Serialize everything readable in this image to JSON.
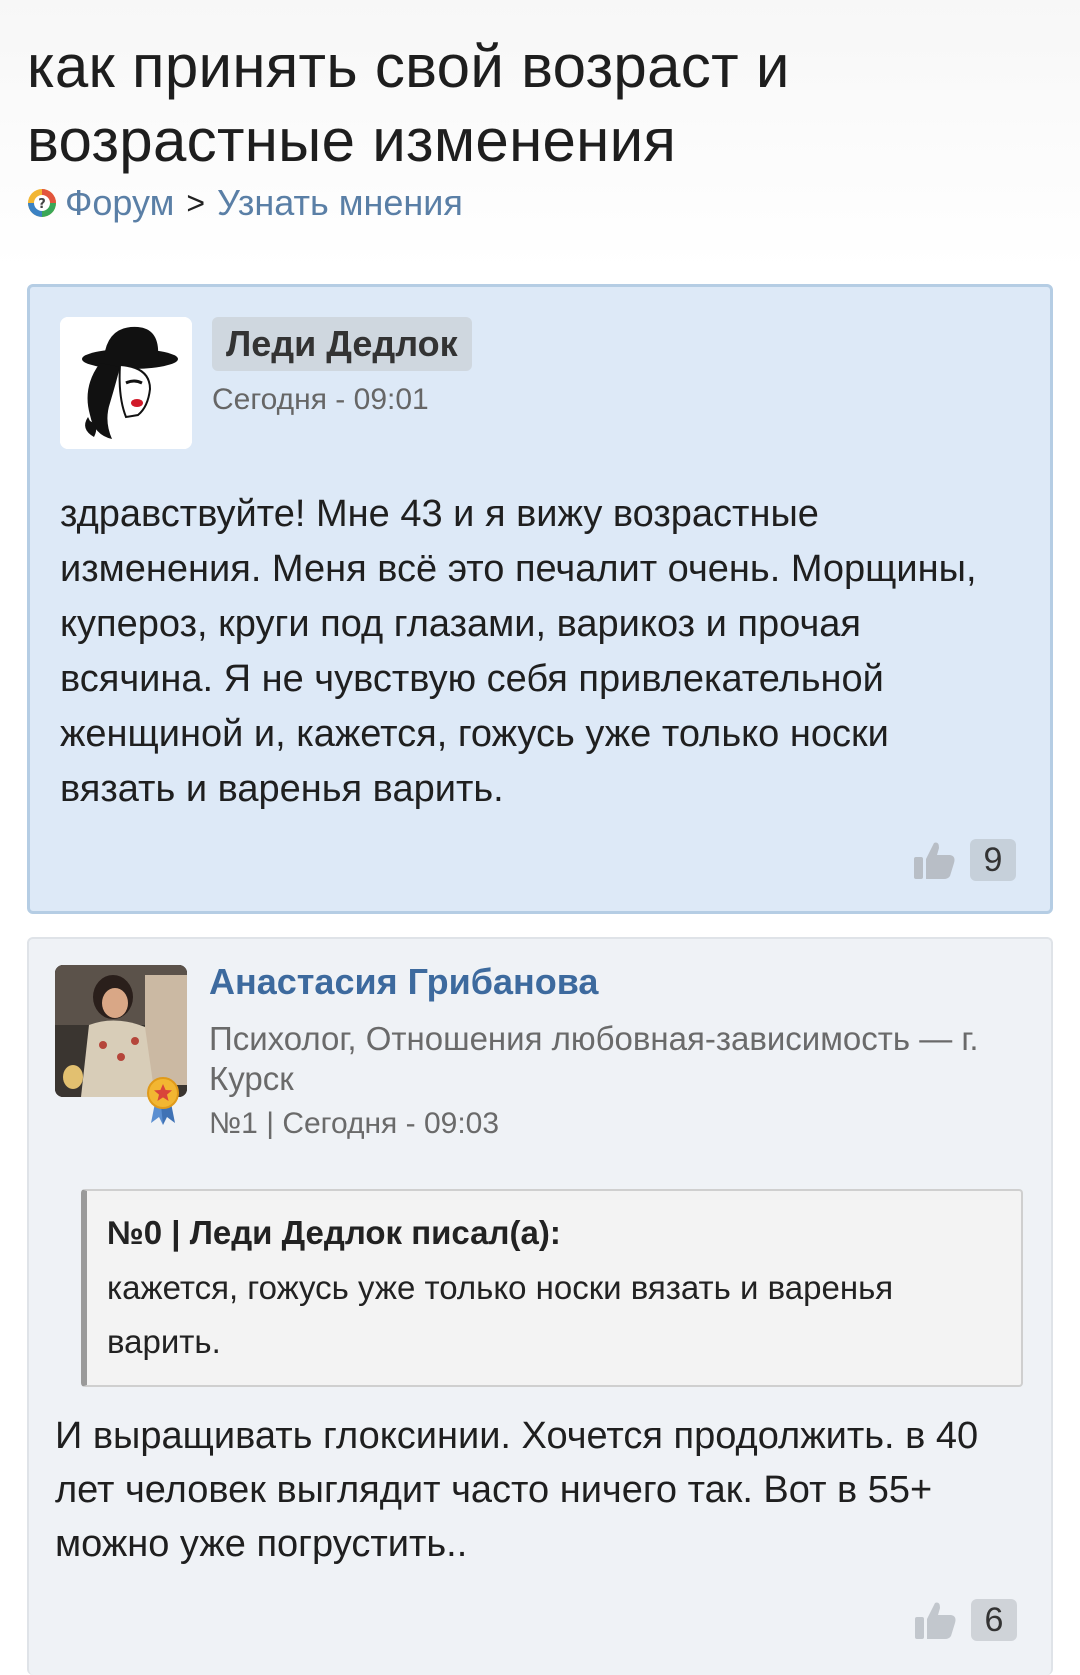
{
  "page": {
    "title": "как принять свой возраст и возрастные изменения"
  },
  "breadcrumb": {
    "forum": "Форум",
    "separator": ">",
    "section": "Узнать мнения",
    "icon": "forum-question-icon"
  },
  "posts": [
    {
      "author": "Леди Дедлок",
      "date": "Сегодня - 09:01",
      "text": "здравствуйте! Мне 43 и я вижу возрастные изменения. Меня всё это печалит очень. Морщины, купероз, круги под глазами, варикоз и прочая всячина. Я не чувствую себя привлекательной женщиной и, кажется, гожусь уже только носки вязать и варенья варить.",
      "likes": "9",
      "avatar": "lady-in-hat-avatar"
    },
    {
      "author": "Анастасия Грибанова",
      "role": "Психолог, Отношения любовная-зависимость — г. Курск",
      "meta": "№1 | Сегодня - 09:03",
      "quote_head": "№0 | Леди Дедлок писал(а):",
      "quote_text": "кажется, гожусь уже только носки вязать и варенья варить.",
      "text": "И выращивать глоксинии. Хочется продолжить. в 40 лет человек выглядит часто ничего так. Вот в 55+ можно уже погрустить..",
      "likes": "6",
      "avatar": "expert-photo-avatar",
      "badge": "expert-badge-icon"
    }
  ],
  "colors": {
    "link": "#5a7fa6",
    "author_link": "#3d6a9e",
    "main_post_bg": "#dde9f7",
    "main_post_border": "#b5cde4",
    "reply_bg": "#eff2f6"
  }
}
